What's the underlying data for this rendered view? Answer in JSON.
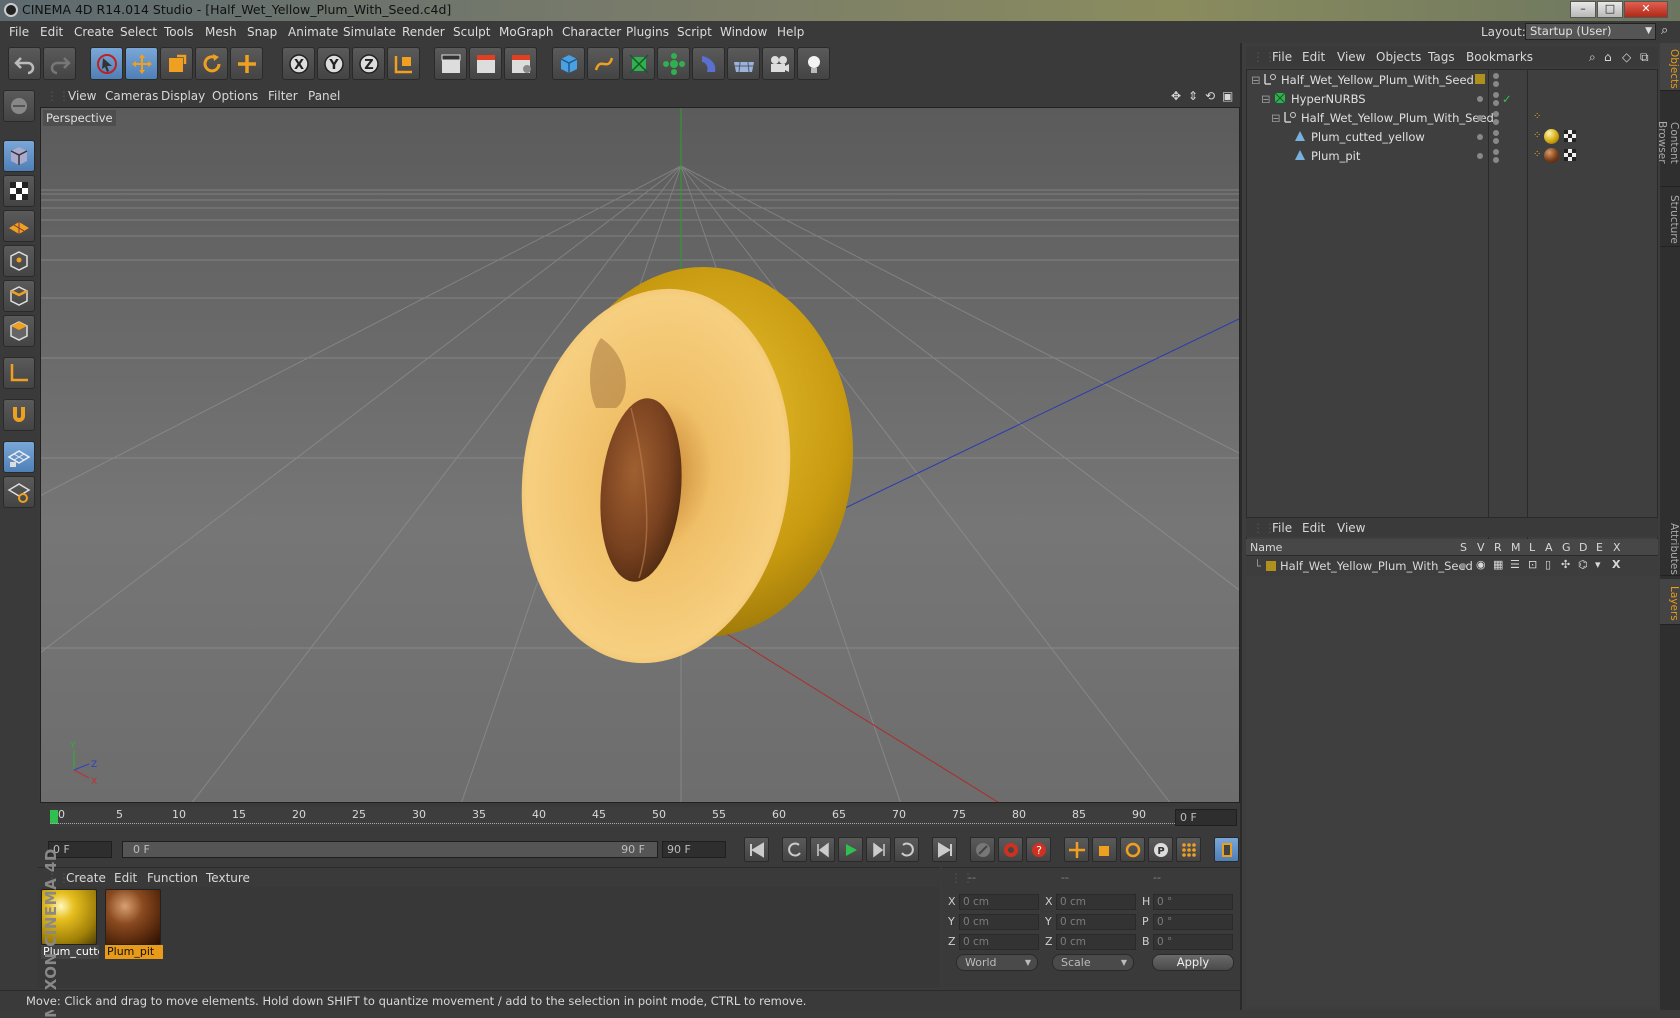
{
  "window": {
    "title": "CINEMA 4D R14.014 Studio - [Half_Wet_Yellow_Plum_With_Seed.c4d]",
    "minimize": "–",
    "maximize": "□",
    "close": "✕"
  },
  "menubar": {
    "items": [
      "File",
      "Edit",
      "Create",
      "Select",
      "Tools",
      "Mesh",
      "Snap",
      "Animate",
      "Simulate",
      "Render",
      "Sculpt",
      "MoGraph",
      "Character",
      "Plugins",
      "Script",
      "Window",
      "Help"
    ],
    "layout_label": "Layout:",
    "layout_value": "Startup (User)"
  },
  "viewport": {
    "menu": [
      "View",
      "Cameras",
      "Display",
      "Options",
      "Filter",
      "Panel"
    ],
    "camera_label": "Perspective"
  },
  "timeline": {
    "ticks": [
      "0",
      "5",
      "10",
      "15",
      "20",
      "25",
      "30",
      "35",
      "40",
      "45",
      "50",
      "55",
      "60",
      "65",
      "70",
      "75",
      "80",
      "85",
      "90"
    ],
    "current_frame": "0 F",
    "start_field": "0 F",
    "range_start": "0 F",
    "range_end": "90 F",
    "end_field": "90 F"
  },
  "material_manager": {
    "menu": [
      "Create",
      "Edit",
      "Function",
      "Texture"
    ],
    "materials": [
      {
        "name": "Plum_cutte",
        "selected": false
      },
      {
        "name": "Plum_pit",
        "selected": true
      }
    ]
  },
  "coordinates": {
    "headers": [
      "--",
      "--",
      "--"
    ],
    "rows": [
      {
        "a_label": "X",
        "a_value": "0 cm",
        "b_label": "X",
        "b_value": "0 cm",
        "c_label": "H",
        "c_value": "0 °"
      },
      {
        "a_label": "Y",
        "a_value": "0 cm",
        "b_label": "Y",
        "b_value": "0 cm",
        "c_label": "P",
        "c_value": "0 °"
      },
      {
        "a_label": "Z",
        "a_value": "0 cm",
        "b_label": "Z",
        "b_value": "0 cm",
        "c_label": "B",
        "c_value": "0 °"
      }
    ],
    "space": "World",
    "mode": "Scale",
    "apply": "Apply"
  },
  "object_manager": {
    "menu": [
      "File",
      "Edit",
      "View",
      "Objects",
      "Tags",
      "Bookmarks"
    ],
    "objects": [
      {
        "name": "Half_Wet_Yellow_Plum_With_Seed",
        "level": 0
      },
      {
        "name": "HyperNURBS",
        "level": 1
      },
      {
        "name": "Half_Wet_Yellow_Plum_With_Seed",
        "level": 2
      },
      {
        "name": "Plum_cutted_yellow",
        "level": 3
      },
      {
        "name": "Plum_pit",
        "level": 3
      }
    ]
  },
  "layer_manager": {
    "menu": [
      "File",
      "Edit",
      "View"
    ],
    "columns": [
      "Name",
      "S",
      "V",
      "R",
      "M",
      "L",
      "A",
      "G",
      "D",
      "E",
      "X"
    ],
    "layers": [
      "Half_Wet_Yellow_Plum_With_Seed"
    ]
  },
  "side_tabs": [
    "Objects",
    "Content Browser",
    "Structure",
    "Attributes",
    "Layers"
  ],
  "statusbar": "Move: Click and drag to move elements. Hold down SHIFT to quantize movement / add to the selection in point mode, CTRL to remove.",
  "branding": "MAXON CINEMA 4D",
  "colors": {
    "accent": "#e89a18",
    "active_tool": "#5b8ec6",
    "x_axis": "#c03030",
    "y_axis": "#30b030",
    "z_axis": "#3040c0"
  }
}
